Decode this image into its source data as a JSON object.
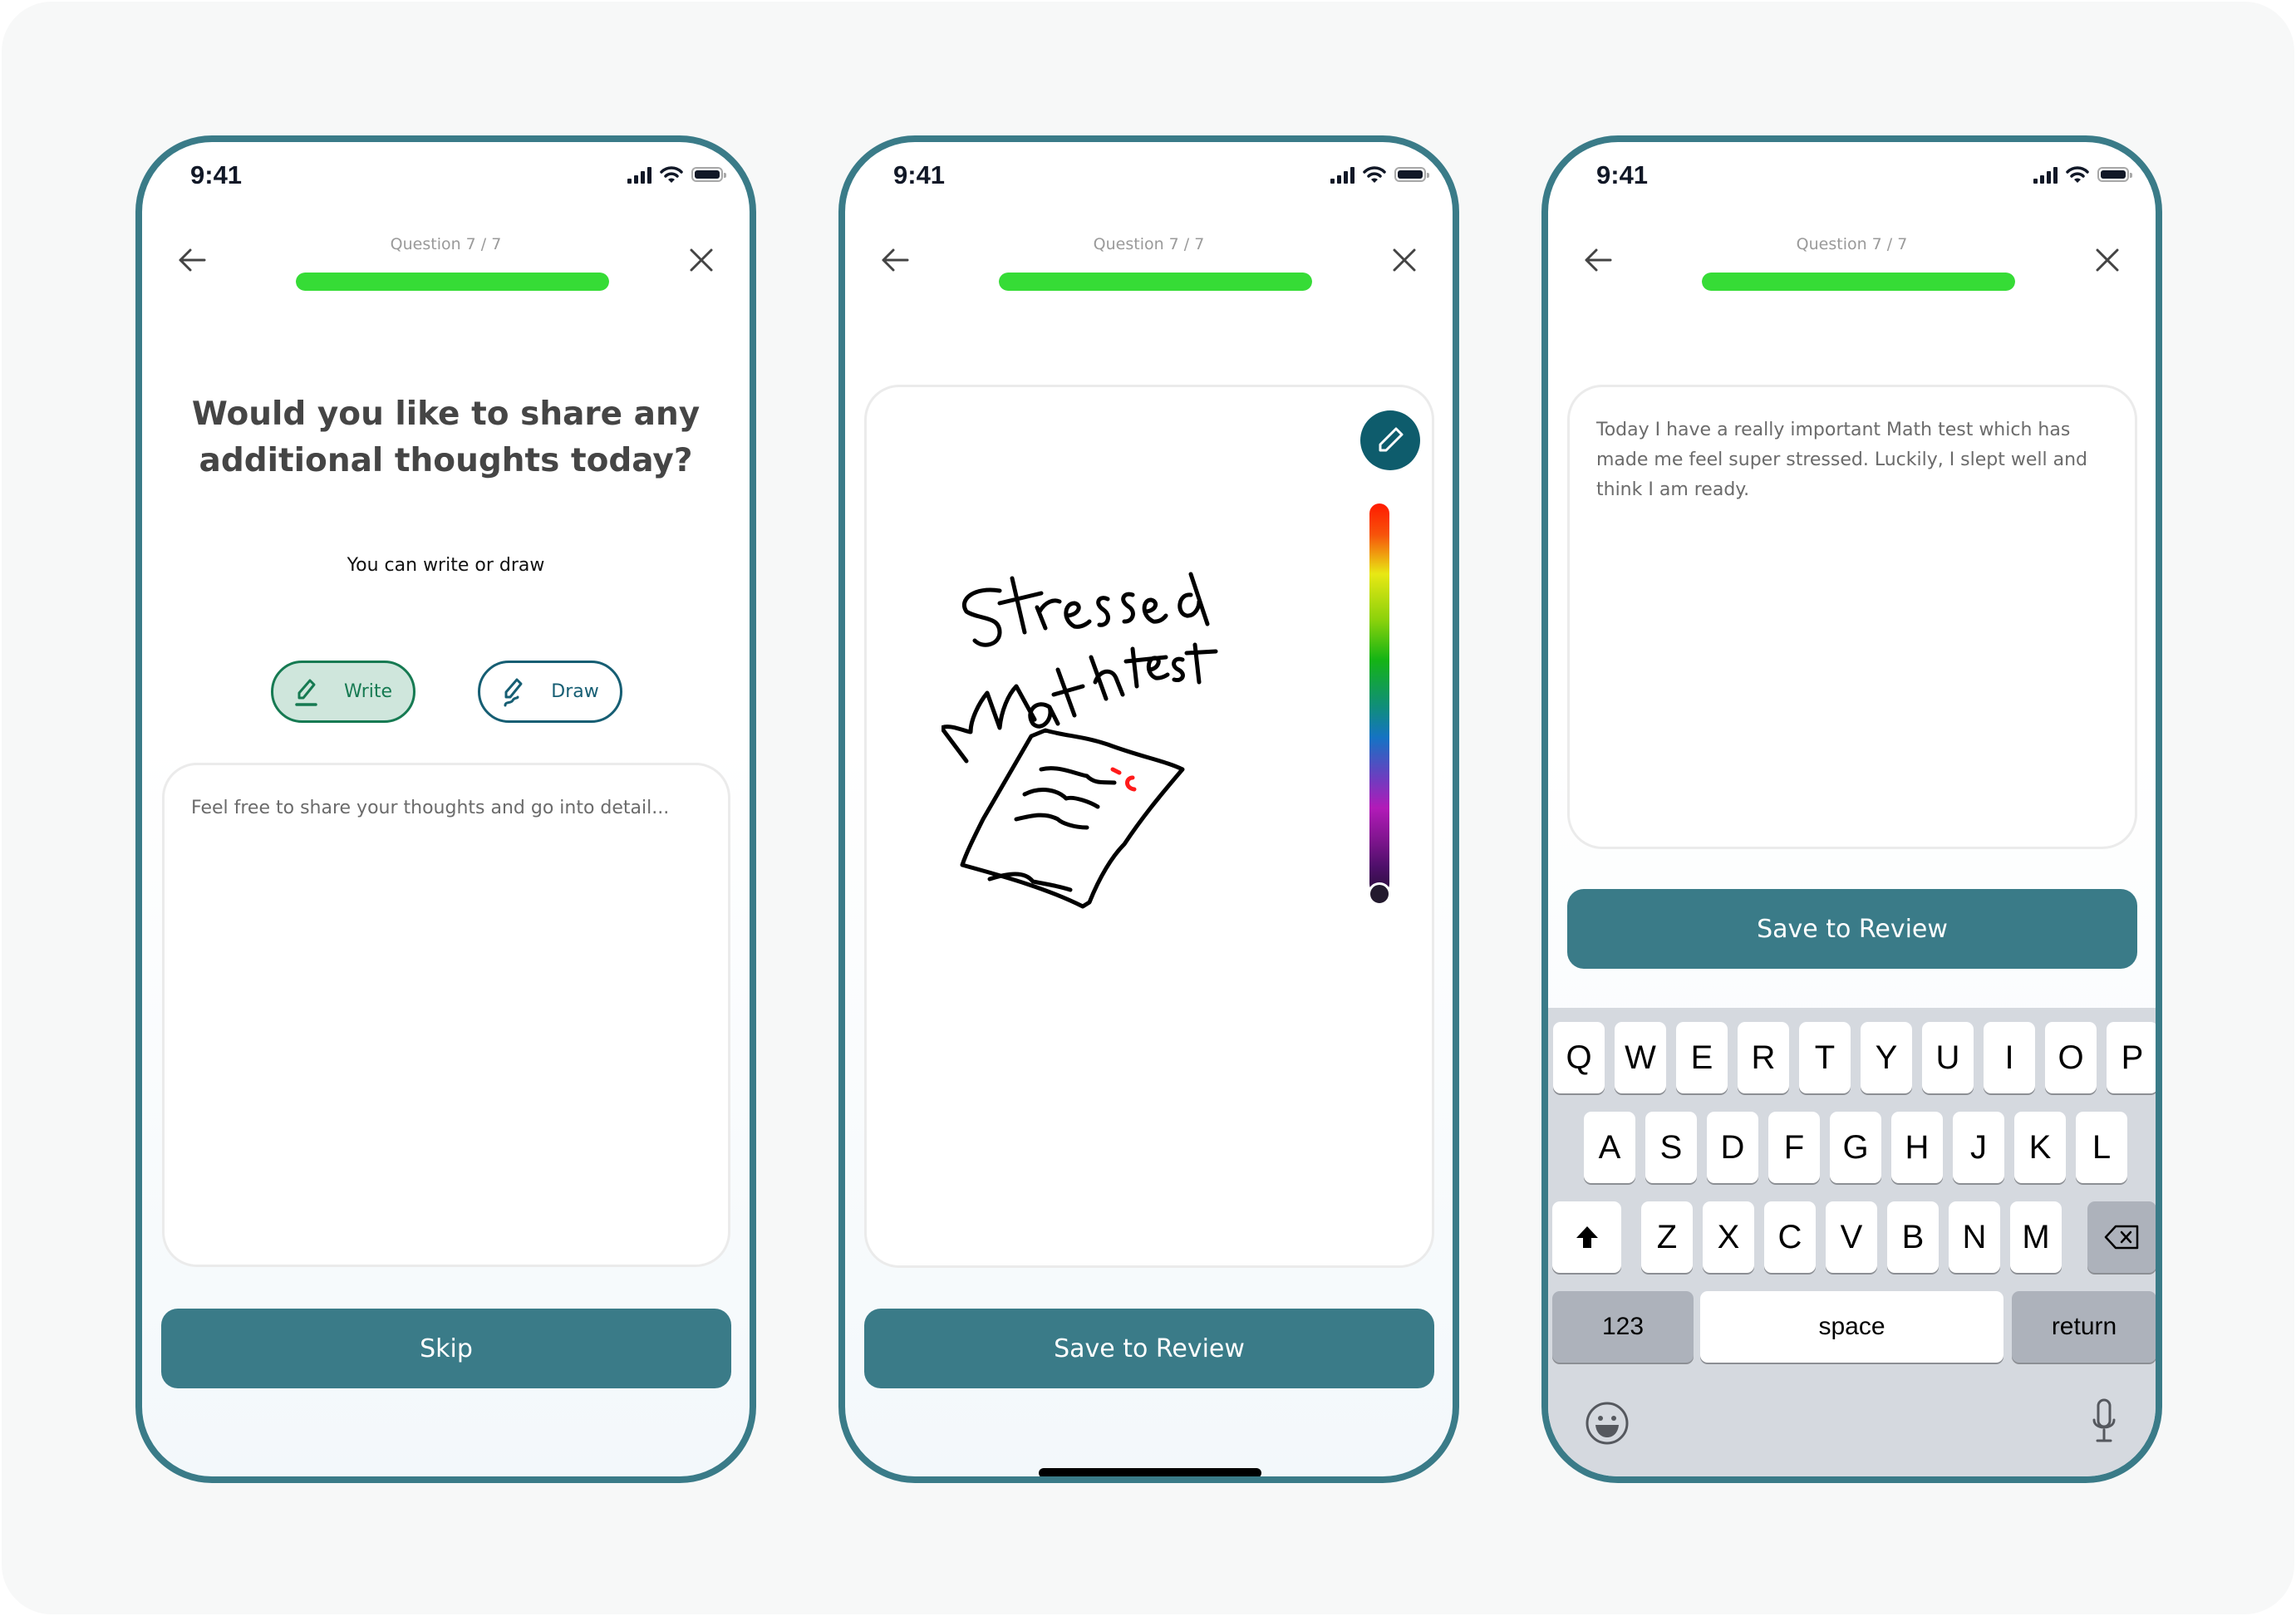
{
  "status_bar": {
    "time": "9:41"
  },
  "header": {
    "progress_label": "Question 7 / 7",
    "progress_fraction": 1.0
  },
  "colors": {
    "frame": "#3a7b88",
    "primary": "#3a7b88",
    "progress": "#36dc36",
    "write_accent": "#167a52",
    "draw_accent": "#165e73"
  },
  "screen_choose": {
    "title": "Would you like to share any additional thoughts today?",
    "subtitle": "You can write or draw",
    "write_label": "Write",
    "draw_label": "Draw",
    "textarea_placeholder": "Feel free to share your thoughts and go into detail...",
    "skip_label": "Skip"
  },
  "screen_draw": {
    "drawing_text": [
      "Stressed",
      "Math",
      "test"
    ],
    "save_label": "Save to Review"
  },
  "screen_write": {
    "textarea_value": "Today I have a really important Math test which has made me feel super stressed. Luckily, I slept well and think I am ready.",
    "save_label": "Save to Review"
  },
  "keyboard": {
    "row1": [
      "Q",
      "W",
      "E",
      "R",
      "T",
      "Y",
      "U",
      "I",
      "O",
      "P"
    ],
    "row2": [
      "A",
      "S",
      "D",
      "F",
      "G",
      "H",
      "J",
      "K",
      "L"
    ],
    "row3": [
      "Z",
      "X",
      "C",
      "V",
      "B",
      "N",
      "M"
    ],
    "numbers_label": "123",
    "space_label": "space",
    "return_label": "return"
  }
}
